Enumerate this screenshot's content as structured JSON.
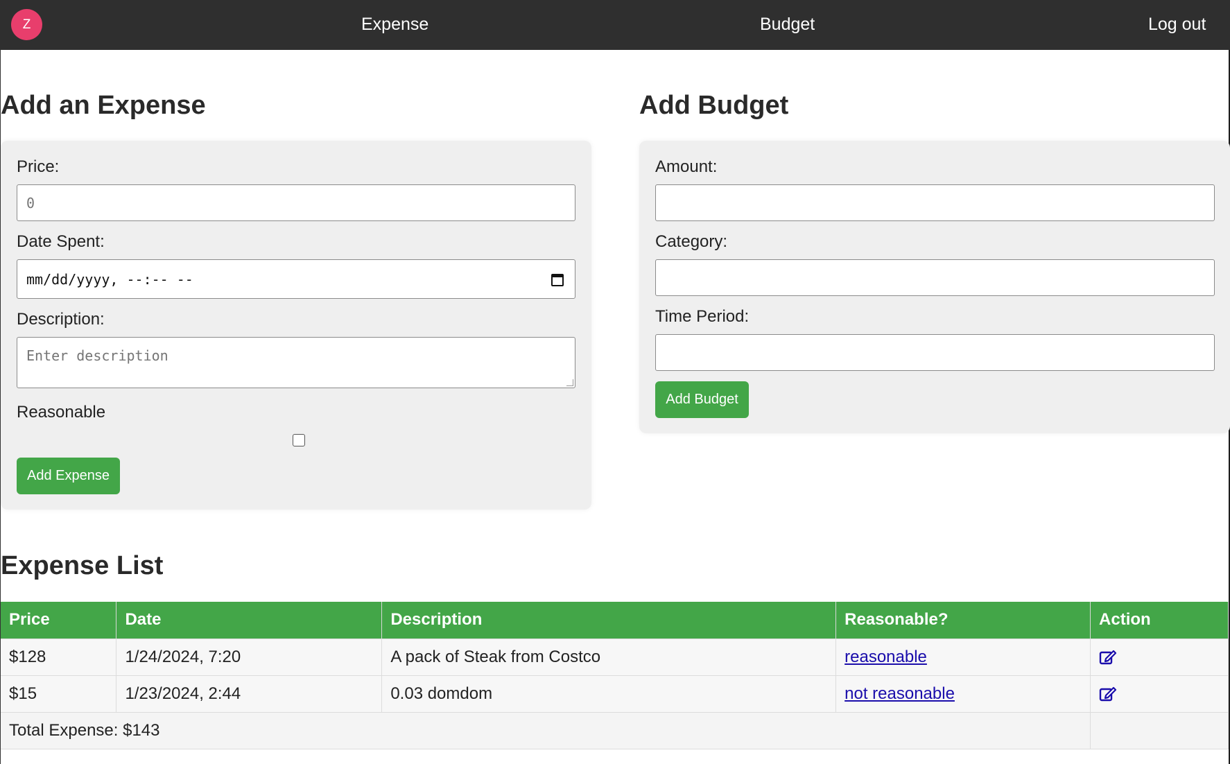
{
  "nav": {
    "avatar_initial": "Z",
    "links": [
      "Expense",
      "Budget",
      "Log out"
    ]
  },
  "expense_form": {
    "title": "Add an Expense",
    "price_label": "Price:",
    "price_value": "0",
    "date_label": "Date Spent:",
    "date_placeholder": "mm/dd/yyyy, --:-- --",
    "description_label": "Description:",
    "description_placeholder": "Enter description",
    "reasonable_label": "Reasonable",
    "reasonable_checked": false,
    "submit_label": "Add Expense"
  },
  "budget_form": {
    "title": "Add Budget",
    "amount_label": "Amount:",
    "amount_value": "",
    "category_label": "Category:",
    "category_value": "",
    "period_label": "Time Period:",
    "period_value": "",
    "submit_label": "Add Budget"
  },
  "expense_list": {
    "title": "Expense List",
    "columns": [
      "Price",
      "Date",
      "Description",
      "Reasonable?",
      "Action"
    ],
    "rows": [
      {
        "price": "$128",
        "date": "1/24/2024, 7:20",
        "description": "A pack of Steak from Costco",
        "reasonable": "reasonable",
        "action_icon": "edit-icon"
      },
      {
        "price": "$15",
        "date": "1/23/2024, 2:44",
        "description": "0.03 domdom",
        "reasonable": "not reasonable",
        "action_icon": "edit-icon"
      }
    ],
    "total_label": "Total Expense: $143"
  },
  "colors": {
    "nav_bg": "#2f2f2f",
    "avatar_bg": "#e83e6c",
    "accent_green": "#43a648",
    "card_bg": "#efefef",
    "link": "#1a0dab"
  }
}
